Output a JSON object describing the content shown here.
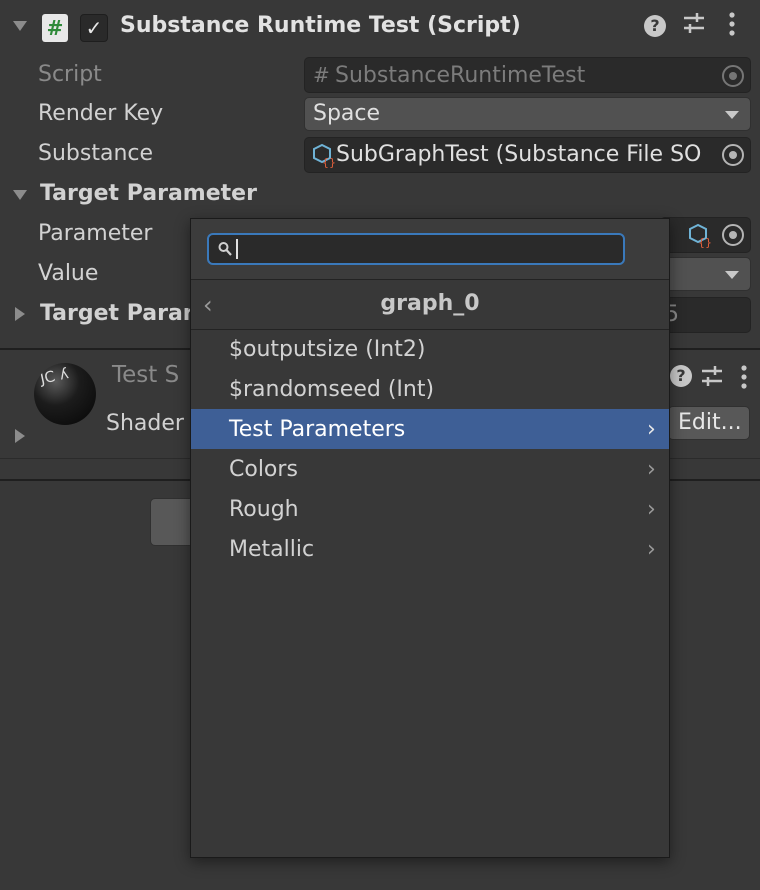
{
  "component": {
    "title": "Substance Runtime Test (Script)",
    "script_icon": "#",
    "enabled": true
  },
  "fields": {
    "script": {
      "label": "Script",
      "value": "SubstanceRuntimeTest"
    },
    "render_key": {
      "label": "Render Key",
      "value": "Space"
    },
    "substance": {
      "label": "Substance",
      "value": "SubGraphTest (Substance File SO"
    },
    "target_parameter": {
      "label": "Target Parameter"
    },
    "parameter": {
      "label": "Parameter"
    },
    "value": {
      "label": "Value"
    },
    "target_param_collapsed": {
      "label": "Target Parar",
      "value_fragment": "5"
    }
  },
  "material": {
    "name": "Test S",
    "shader_label": "Shader",
    "edit_button": "Edit..."
  },
  "popup": {
    "search_placeholder": "",
    "header": "graph_0",
    "items": [
      {
        "label": "$outputsize (Int2)",
        "has_submenu": false,
        "selected": false
      },
      {
        "label": "$randomseed (Int)",
        "has_submenu": false,
        "selected": false
      },
      {
        "label": "Test Parameters",
        "has_submenu": true,
        "selected": true
      },
      {
        "label": "Colors",
        "has_submenu": true,
        "selected": false
      },
      {
        "label": "Rough",
        "has_submenu": true,
        "selected": false
      },
      {
        "label": "Metallic",
        "has_submenu": true,
        "selected": false
      }
    ]
  },
  "icons": {
    "help": "question-icon",
    "presets": "sliders-icon",
    "menu": "kebab-icon",
    "chevron": "chevron-right-icon",
    "back": "chevron-left-icon"
  },
  "colors": {
    "background": "#383838",
    "selected": "#3e5f96",
    "search_border": "#3a79bb"
  }
}
